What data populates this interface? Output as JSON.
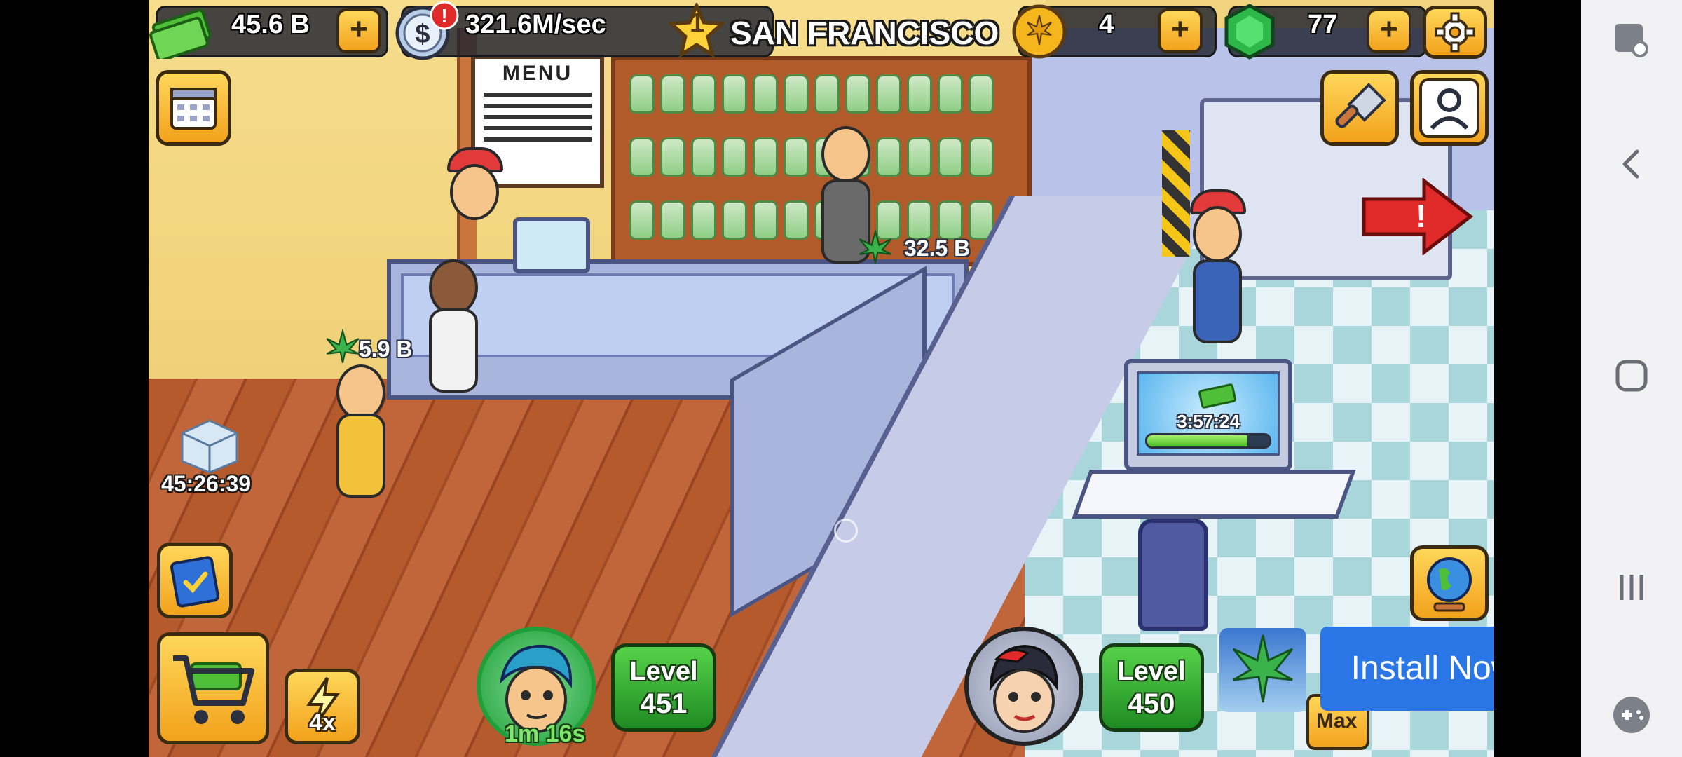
{
  "hud": {
    "cash": "45.6 B",
    "income_rate": "321.6M/sec",
    "city_rank": "1",
    "city_name": "SAN FRANCISCO",
    "coins": "4",
    "gems": "77",
    "plus_label": "+"
  },
  "scene": {
    "menu_board_title": "MENU",
    "customer_earnings": [
      "5.9 B",
      "32.5 B"
    ],
    "box_timer": "45:26:39",
    "lab_timer": "3:57:24",
    "lab_progress": 0.82,
    "speed_boost": "4x"
  },
  "managers": [
    {
      "level_label": "Level",
      "level": "451",
      "timer": "1m 16s"
    },
    {
      "level_label": "Level",
      "level": "450"
    }
  ],
  "ad": {
    "install_label": "Install Now",
    "max_label": "Max"
  },
  "icons": {
    "cash": "cash-stack-icon",
    "income": "dollar-coin-icon",
    "alert": "exclamation-icon",
    "rank": "star-icon",
    "coin": "leaf-coin-icon",
    "gem": "gem-icon",
    "settings": "gear-icon",
    "calendar": "calendar-icon",
    "build": "trowel-icon",
    "profile": "profile-icon",
    "book": "book-icon",
    "globe": "globe-icon",
    "shop": "shopping-cart-icon",
    "boost": "lightning-icon"
  },
  "colors": {
    "hud_bg": "#1e2230",
    "button_gold": "#f2a21c",
    "level_green": "#1e8b22",
    "install_blue": "#2b76e6",
    "alert_red": "#e02a2a"
  }
}
